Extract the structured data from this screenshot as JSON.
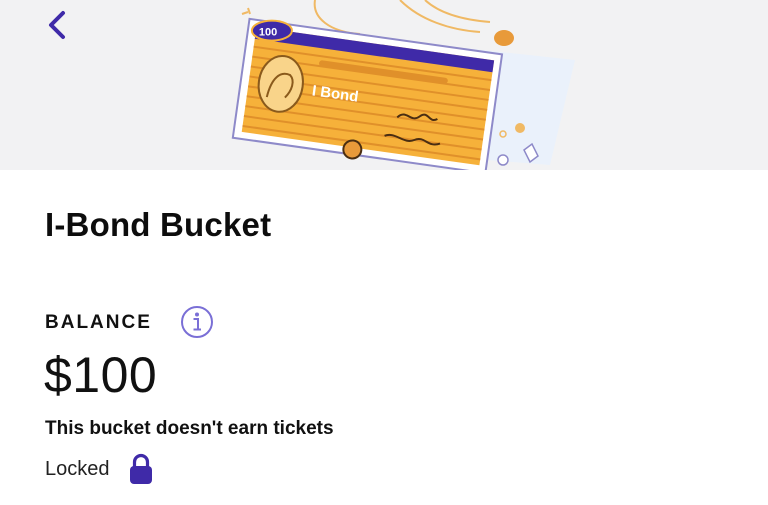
{
  "header": {
    "back_icon": "chevron-left-icon",
    "accent_color": "#3f2aa8"
  },
  "illustration": {
    "bond_label": "I Bond",
    "bond_value": "100",
    "colors": {
      "bond_fill": "#f6b13a",
      "band": "#3f2aa8",
      "coin": "#e89a3a"
    }
  },
  "bucket": {
    "title": "I-Bond Bucket",
    "balance_label": "BALANCE",
    "info_icon": "info-icon",
    "balance_amount": "$100",
    "tickets_note": "This bucket doesn't earn tickets",
    "status_text": "Locked",
    "status_icon": "lock-icon"
  }
}
